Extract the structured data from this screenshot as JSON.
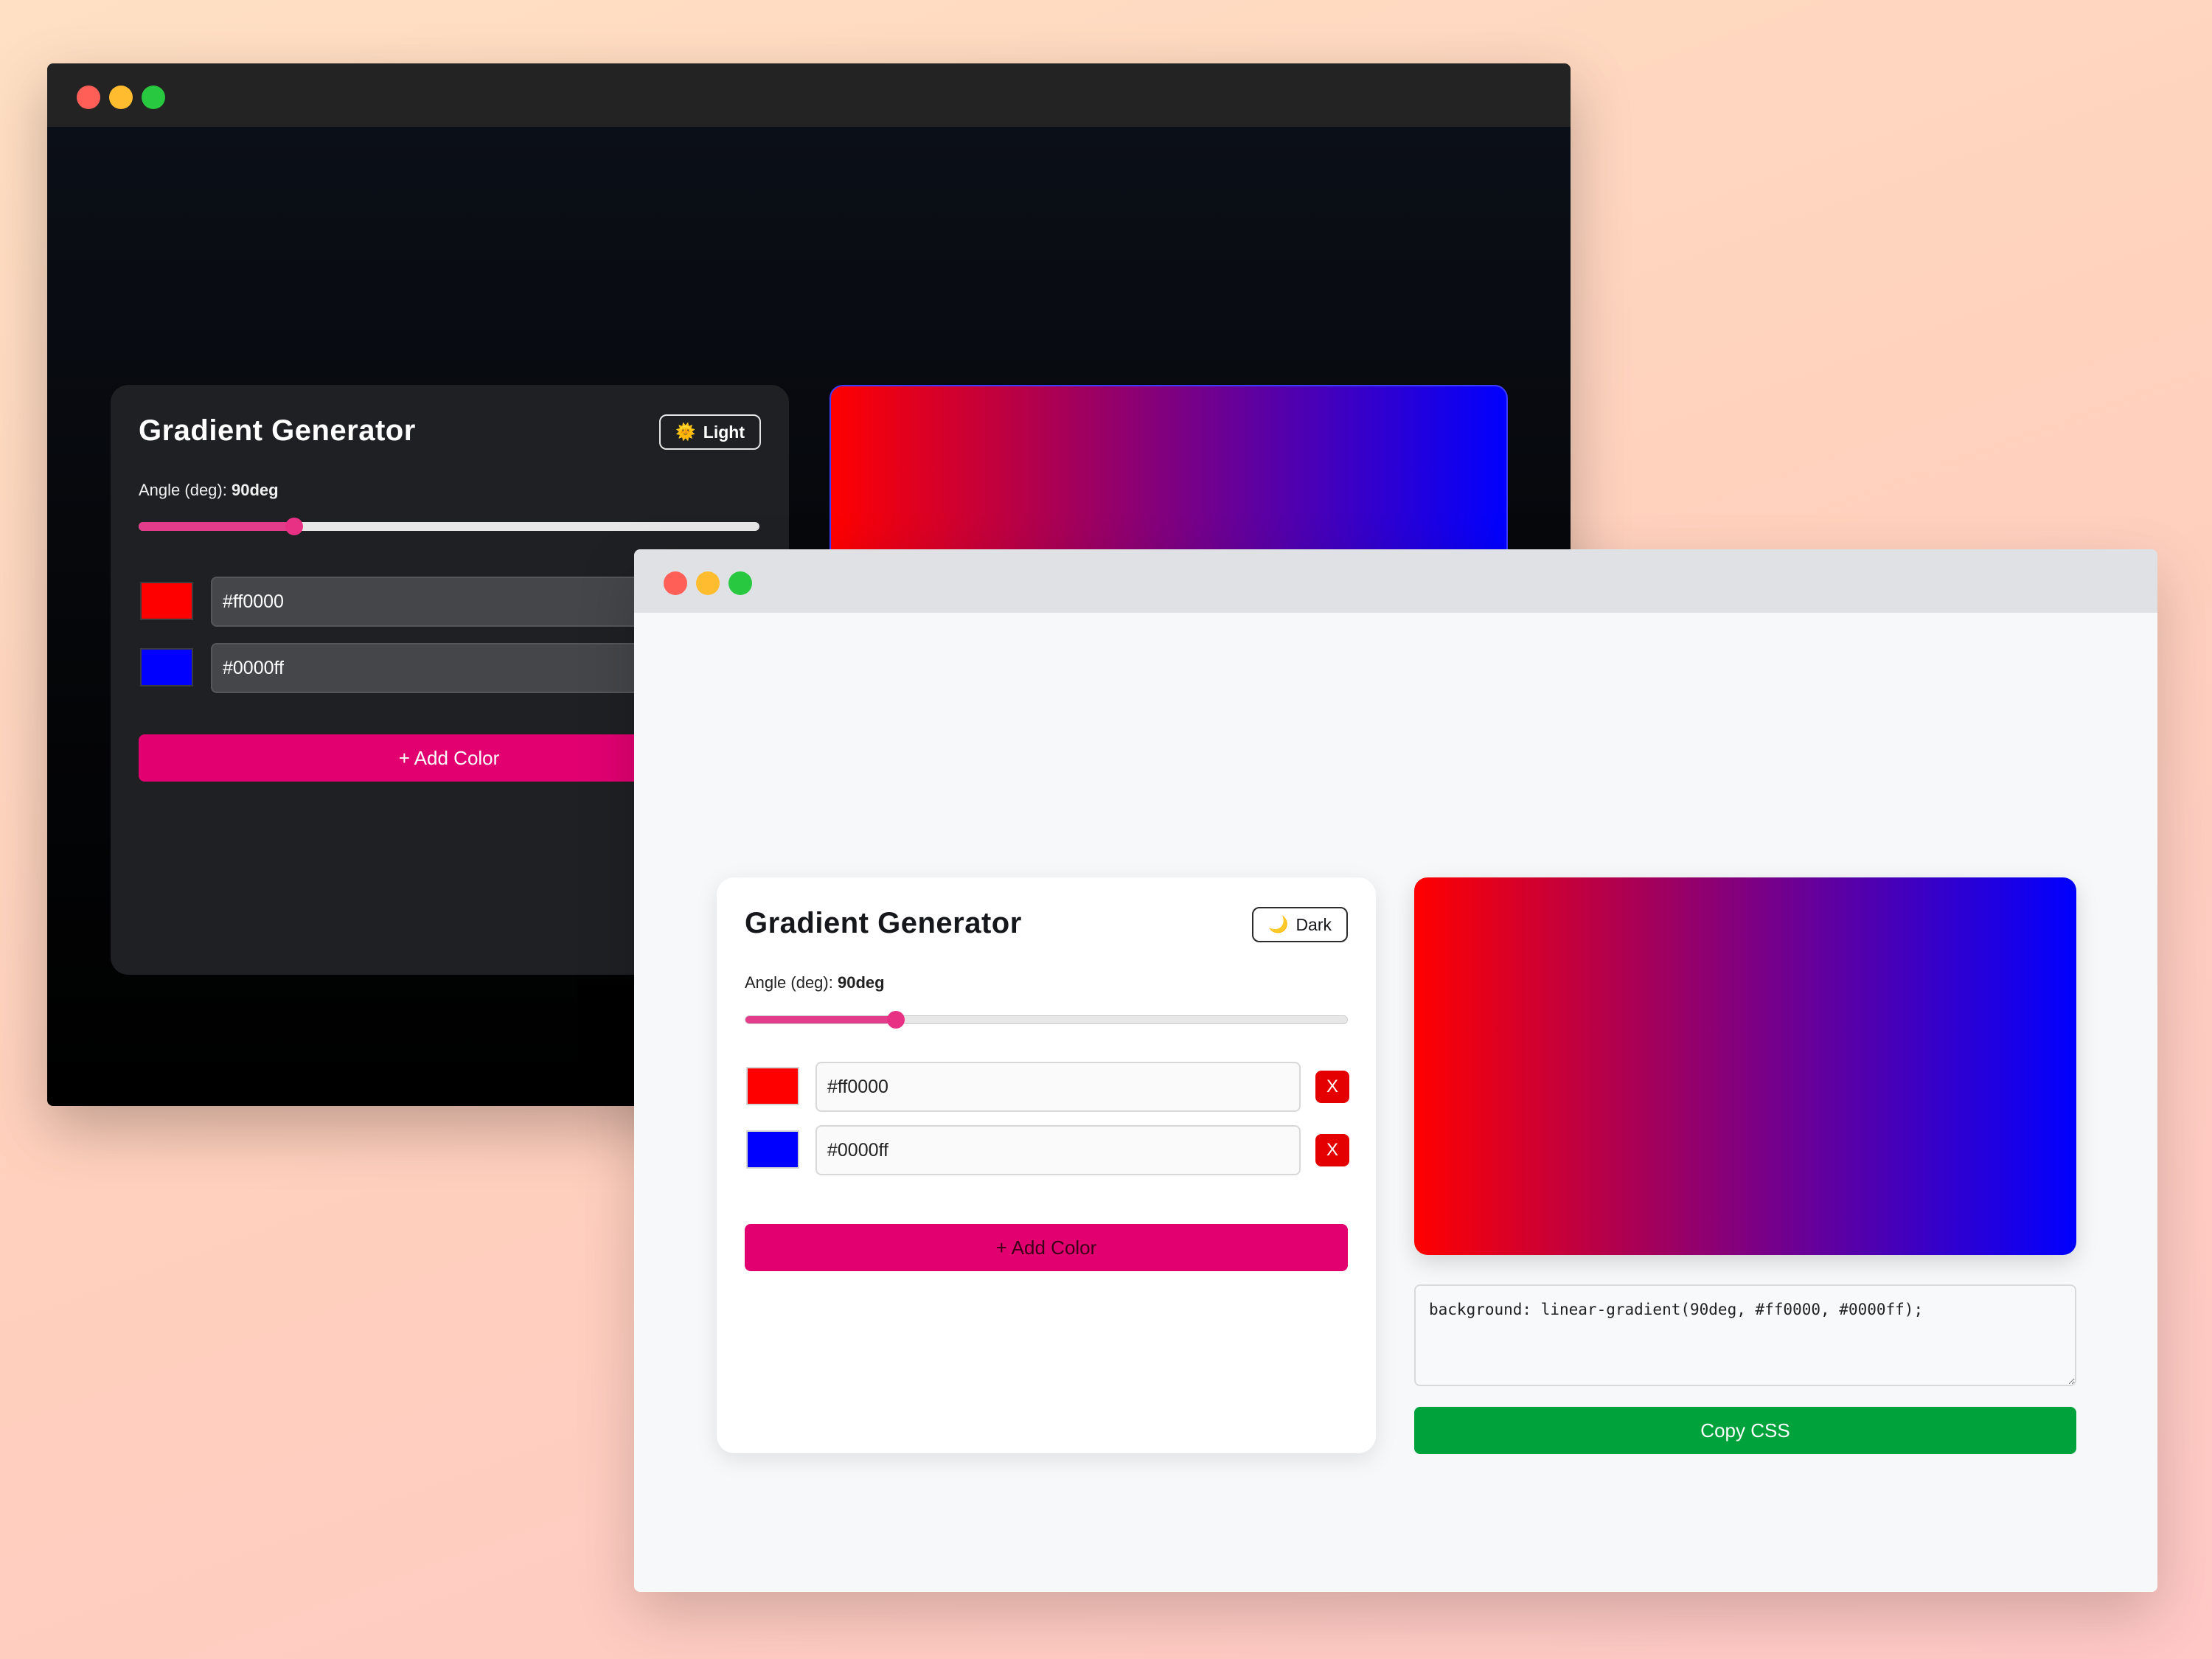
{
  "app_title": "Gradient Generator",
  "angle": {
    "label": "Angle (deg): ",
    "value": "90deg",
    "min": 0,
    "max": 360,
    "current": 90
  },
  "colors": [
    {
      "hex": "#ff0000",
      "remove_label": "X"
    },
    {
      "hex": "#0000ff",
      "remove_label": "X"
    }
  ],
  "add_color_label": "+ Add Color",
  "dark_window": {
    "theme_toggle_icon": "sun-icon",
    "theme_toggle_label": "Light"
  },
  "light_window": {
    "theme_toggle_icon": "moon-icon",
    "theme_toggle_label": "Dark",
    "css_output": "background: linear-gradient(90deg, #ff0000, #0000ff);",
    "copy_label": "Copy CSS"
  },
  "accent_colors": {
    "add_button": "#e20071",
    "copy_button": "#00a23b",
    "remove_button": "#e40000",
    "slider": "#e23c8b"
  }
}
